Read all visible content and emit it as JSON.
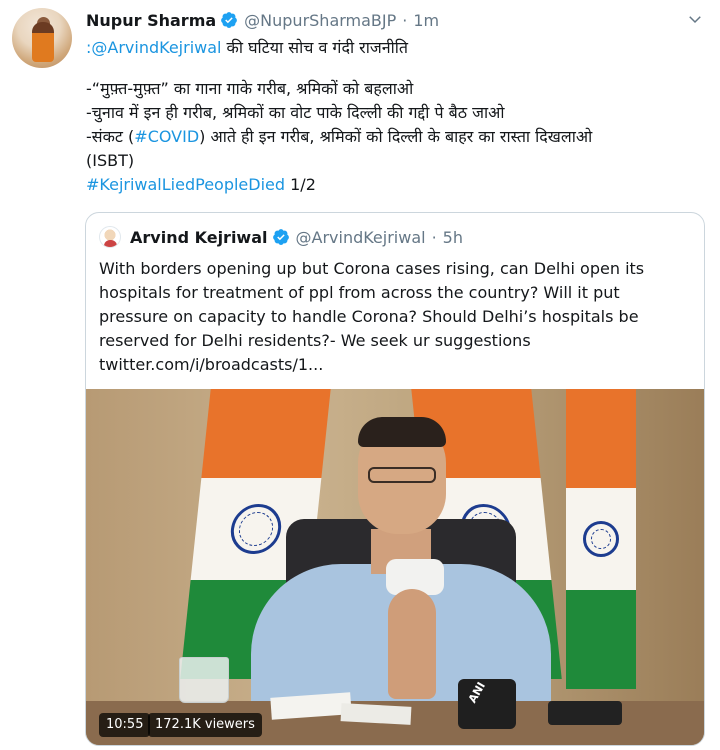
{
  "tweet": {
    "author_name": "Nupur Sharma",
    "author_handle": "@NupurSharmaBJP",
    "separator": "·",
    "time": "1m",
    "lines": {
      "l1_mention": ":@ArvindKejriwal",
      "l1_rest": " की घटिया सोच व गंदी राजनीति",
      "l2": "-“मुफ़्त-मुफ़्त” का गाना गाके गरीब, श्रमिकों को बहलाओ",
      "l3": "-चुनाव में इन ही गरीब, श्रमिकों का वोट पाके दिल्ली की गद्दी पे बैठ जाओ",
      "l4_pre": "-संकट (",
      "l4_tag": "#COVID",
      "l4_post": ") आते ही इन गरीब, श्रमिकों को दिल्ली के बाहर का रास्ता दिखलाओ",
      "l5": "(ISBT)",
      "l6_tag": "#KejriwalLiedPeopleDied",
      "l6_rest": " 1/2"
    }
  },
  "quote": {
    "author_name": "Arvind Kejriwal",
    "author_handle": "@ArvindKejriwal",
    "separator": "·",
    "time": "5h",
    "lines": [
      "With borders opening up but Corona cases rising, can Delhi open its",
      "hospitals for treatment of ppl from across the country? Will it put",
      "pressure on capacity to handle Corona? Should Delhi’s hospitals be",
      "reserved for Delhi residents?- We seek ur suggestions",
      "twitter.com/i/broadcasts/1..."
    ],
    "video": {
      "duration": "10:55",
      "viewers": "172.1K viewers",
      "mic_label": "ANI"
    }
  },
  "colors": {
    "link": "#1b95e0",
    "verified": "#1da1f2",
    "secondary_text": "#657786",
    "border": "#ccd6dd"
  },
  "icons": {
    "verified": "verified-badge-icon",
    "caret": "chevron-down-icon"
  }
}
